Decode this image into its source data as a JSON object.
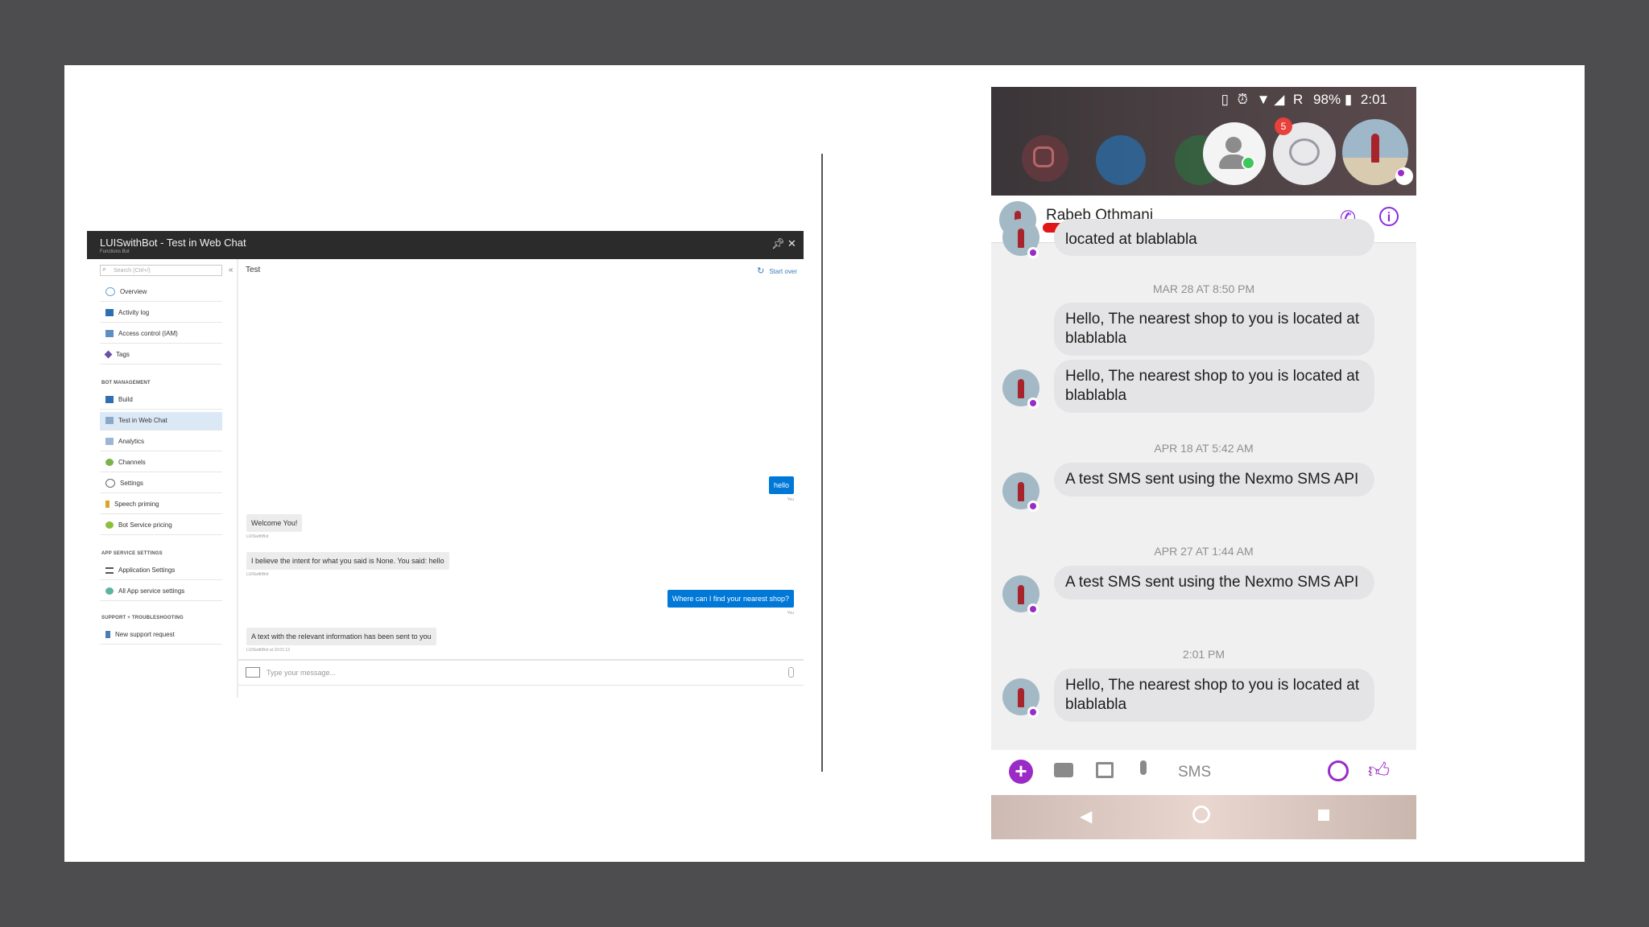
{
  "azure": {
    "title": "LUISwithBot - Test in Web Chat",
    "subtitle": "Functions Bot",
    "pin_icon": "pin-icon",
    "close_icon": "close-icon",
    "search_placeholder": "Search (Ctrl+/)",
    "collapse": "«",
    "nav_top": [
      {
        "label": "Overview",
        "icon": "overview-icon"
      },
      {
        "label": "Activity log",
        "icon": "activity-log-icon"
      },
      {
        "label": "Access control (IAM)",
        "icon": "access-control-icon"
      },
      {
        "label": "Tags",
        "icon": "tag-icon"
      }
    ],
    "section_bot": "BOT MANAGEMENT",
    "nav_bot": [
      {
        "label": "Build",
        "icon": "build-icon"
      },
      {
        "label": "Test in Web Chat",
        "icon": "test-web-chat-icon",
        "active": true
      },
      {
        "label": "Analytics",
        "icon": "analytics-icon"
      },
      {
        "label": "Channels",
        "icon": "channels-icon"
      },
      {
        "label": "Settings",
        "icon": "settings-icon"
      },
      {
        "label": "Speech priming",
        "icon": "speech-priming-icon"
      },
      {
        "label": "Bot Service pricing",
        "icon": "pricing-icon"
      }
    ],
    "section_app": "APP SERVICE SETTINGS",
    "nav_app": [
      {
        "label": "Application Settings",
        "icon": "app-settings-icon"
      },
      {
        "label": "All App service settings",
        "icon": "all-settings-icon"
      }
    ],
    "section_support": "SUPPORT + TROUBLESHOOTING",
    "nav_support": [
      {
        "label": "New support request",
        "icon": "support-icon"
      }
    ],
    "chat": {
      "header": "Test",
      "start_over": "Start over",
      "messages": [
        {
          "from": "user",
          "text": "hello",
          "meta": "You"
        },
        {
          "from": "bot",
          "text": "Welcome You!",
          "meta": "LUISwithBot"
        },
        {
          "from": "bot",
          "text": "I believe the intent for what you said is None. You said: hello",
          "meta": "LUISwithBot"
        },
        {
          "from": "user",
          "text": "Where can I find your nearest shop?",
          "meta": "You"
        },
        {
          "from": "bot",
          "text": "A text with the relevant information has been sent to you",
          "meta": "LUISwithBot at 10:01:13"
        }
      ],
      "input_placeholder": "Type your message..."
    },
    "colors": {
      "titlebar": "#2b2b2b",
      "accent": "#0078d7",
      "active_nav": "#dbe9f7"
    }
  },
  "phone": {
    "status": {
      "battery": "98%",
      "time": "2:01",
      "network": "R"
    },
    "badge_count": "5",
    "contact_name": "Rabeb Othmani",
    "partial_message": "located at blablabla",
    "thread": [
      {
        "type": "timestamp",
        "text": "MAR 28 AT 8:50 PM"
      },
      {
        "type": "message",
        "text": "Hello, The nearest shop to you is located at blablabla"
      },
      {
        "type": "message",
        "text": "Hello, The nearest shop to you is located at blablabla"
      },
      {
        "type": "timestamp",
        "text": "APR 18 AT 5:42 AM"
      },
      {
        "type": "message",
        "text": "A test SMS sent using the Nexmo SMS API"
      },
      {
        "type": "timestamp",
        "text": "APR 27 AT 1:44 AM"
      },
      {
        "type": "message",
        "text": "A test SMS sent using the Nexmo SMS API"
      },
      {
        "type": "timestamp",
        "text": "2:01 PM"
      },
      {
        "type": "message",
        "text": "Hello, The nearest shop to you is located at blablabla"
      }
    ],
    "composer_placeholder": "SMS",
    "colors": {
      "messenger_accent": "#8a2be2",
      "bubble": "#e4e4e6",
      "redaction": "#e01717"
    }
  }
}
